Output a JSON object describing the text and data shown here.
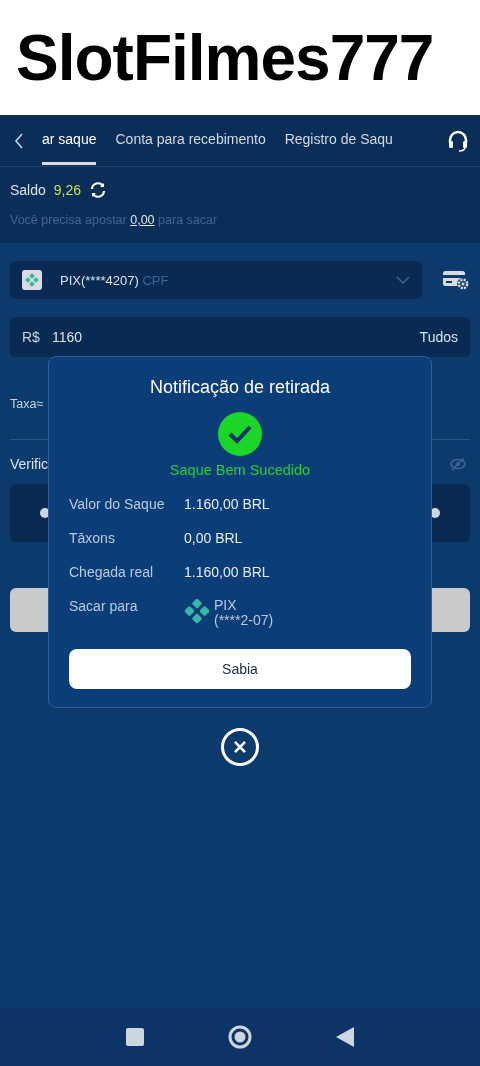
{
  "banner": {
    "title": "SlotFilmes777"
  },
  "tabs": [
    {
      "label": "ar saque",
      "selected": true
    },
    {
      "label": "Conta para recebimento",
      "selected": false
    },
    {
      "label": "Registro de Saqu",
      "selected": false
    }
  ],
  "balance": {
    "label": "Saldo",
    "value": "9,26"
  },
  "wager_hint": {
    "before": "Você precisa apostar",
    "amount": "0,00",
    "after": "para sacar"
  },
  "account_select": {
    "value": "PIX(****4207)",
    "type": "CPF"
  },
  "amount_field": {
    "currency": "R$",
    "value": "1160",
    "all_button": "Tudos"
  },
  "fee_label": "Taxa≈",
  "verify_label": "Verific",
  "dialog": {
    "title": "Notificação de retirada",
    "status": "Saque Bem Sucedido",
    "rows": [
      {
        "kind": "text",
        "label": "Valor do Saque",
        "value": "1.160,00 BRL"
      },
      {
        "kind": "text",
        "label": "Tāxons",
        "value": "0,00 BRL"
      },
      {
        "kind": "text",
        "label": "Chegada real",
        "value": "1.160,00 BRL"
      },
      {
        "kind": "account",
        "label": "Sacar para",
        "value": "PIX",
        "detail": "(****2-07)"
      }
    ],
    "button": "Sabia"
  }
}
